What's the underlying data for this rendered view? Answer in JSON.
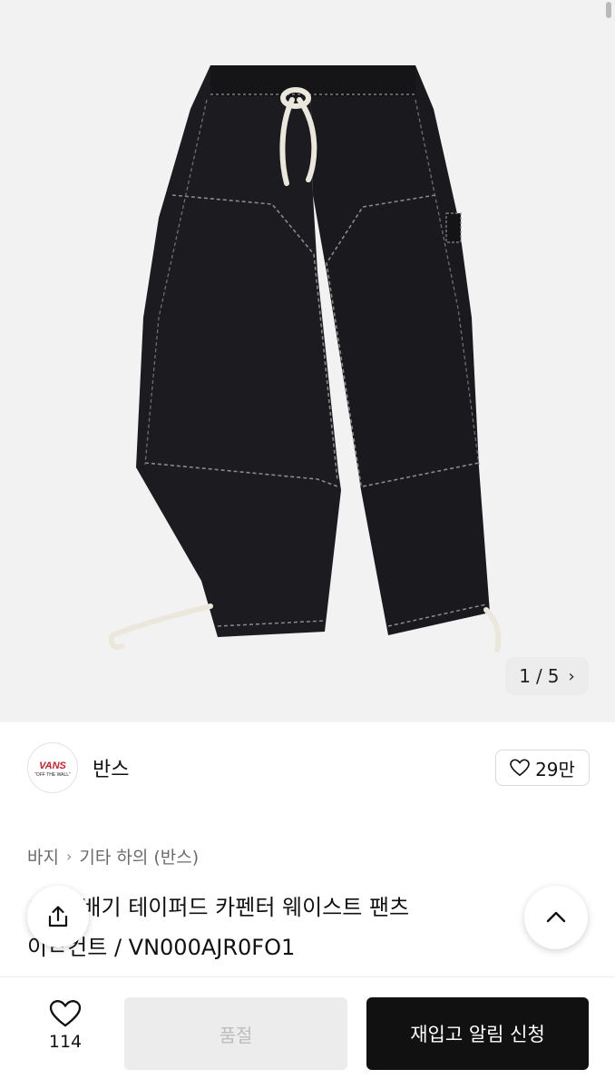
{
  "gallery": {
    "counter_current": "1",
    "counter_sep": "/",
    "counter_total": "5",
    "next_icon": "chevron-right-icon",
    "image_subject": "black carpenter pants"
  },
  "brand": {
    "name": "반스",
    "logo_text_main": "VANS",
    "logo_text_sub": "\"OFF THE WALL\"",
    "logo_color": "#d0202a",
    "like_icon": "heart-icon",
    "like_count": "29만"
  },
  "breadcrumb": {
    "items": [
      "바지",
      "기타 하의 (반스)"
    ],
    "separator_icon": "chevron-right-icon"
  },
  "product": {
    "title_line1": "ㄹ  지 배기 테이퍼드 카펜터 웨이스트 팬츠",
    "title_line2": "이ㄹ컨트 / VN000AJR0FO1"
  },
  "floating": {
    "share_icon": "share-icon",
    "top_icon": "chevron-up-icon"
  },
  "bottom_bar": {
    "wish_icon": "heart-icon",
    "wish_count": "114",
    "soldout_label": "품절",
    "restock_label": "재입고 알림 신청"
  }
}
